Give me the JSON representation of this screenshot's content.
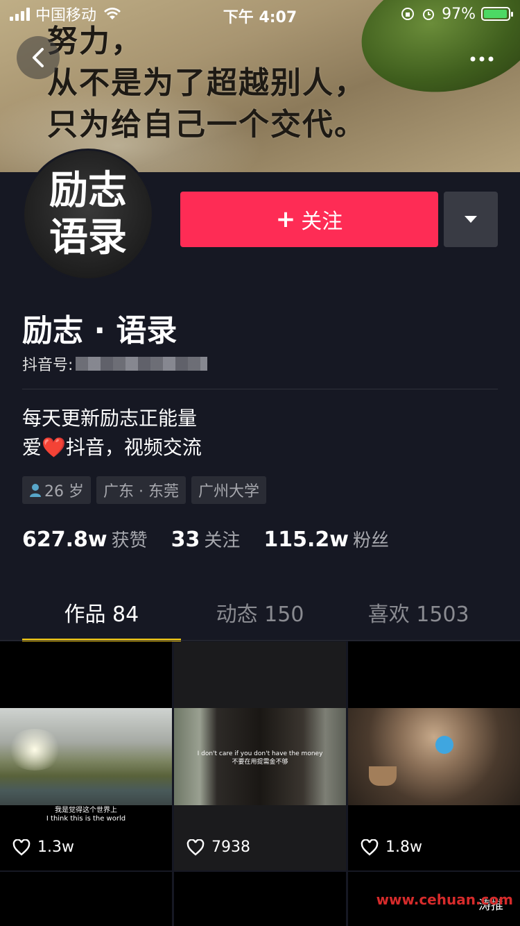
{
  "status_bar": {
    "carrier": "中国移动",
    "time": "下午 4:07",
    "battery": "97%"
  },
  "banner": {
    "lines": [
      "努力，",
      "从不是为了超越别人，",
      "只为给自己一个交代。"
    ]
  },
  "header": {
    "back_icon": "chevron-left-icon",
    "more_icon": "more-dots-icon"
  },
  "avatar": {
    "lines": [
      "励志",
      "语录"
    ]
  },
  "actions": {
    "follow_label": "关注",
    "follow_plus": "+"
  },
  "profile": {
    "nickname": "励志 · 语录",
    "id_label": "抖音号:",
    "bio_line1": "每天更新励志正能量",
    "bio_line2_prefix": "爱",
    "bio_line2_emoji": "❤️",
    "bio_line2_suffix": "抖音，视频交流",
    "tags": [
      "26 岁",
      "广东 · 东莞",
      "广州大学"
    ]
  },
  "stats": [
    {
      "num": "627.8w",
      "label": "获赞"
    },
    {
      "num": "33",
      "label": "关注"
    },
    {
      "num": "115.2w",
      "label": "粉丝"
    }
  ],
  "tabs": [
    {
      "label": "作品 84",
      "active": true
    },
    {
      "label": "动态 150",
      "active": false
    },
    {
      "label": "喜欢 1503",
      "active": false
    }
  ],
  "videos": [
    {
      "likes": "1.3w",
      "subtitle_cn": "我是觉得这个世界上",
      "subtitle_en": "I think this is the world"
    },
    {
      "likes": "7938",
      "subtitle_en": "I don't care if you don't have the money",
      "subtitle_cn": "不要在用提需金不够"
    },
    {
      "likes": "1.8w"
    }
  ],
  "watermark": {
    "url": "www.cehuan.com",
    "label": "涛推"
  },
  "colors": {
    "background": "#161823",
    "follow_button": "#fe2c55",
    "tab_indicator": "#face15"
  }
}
